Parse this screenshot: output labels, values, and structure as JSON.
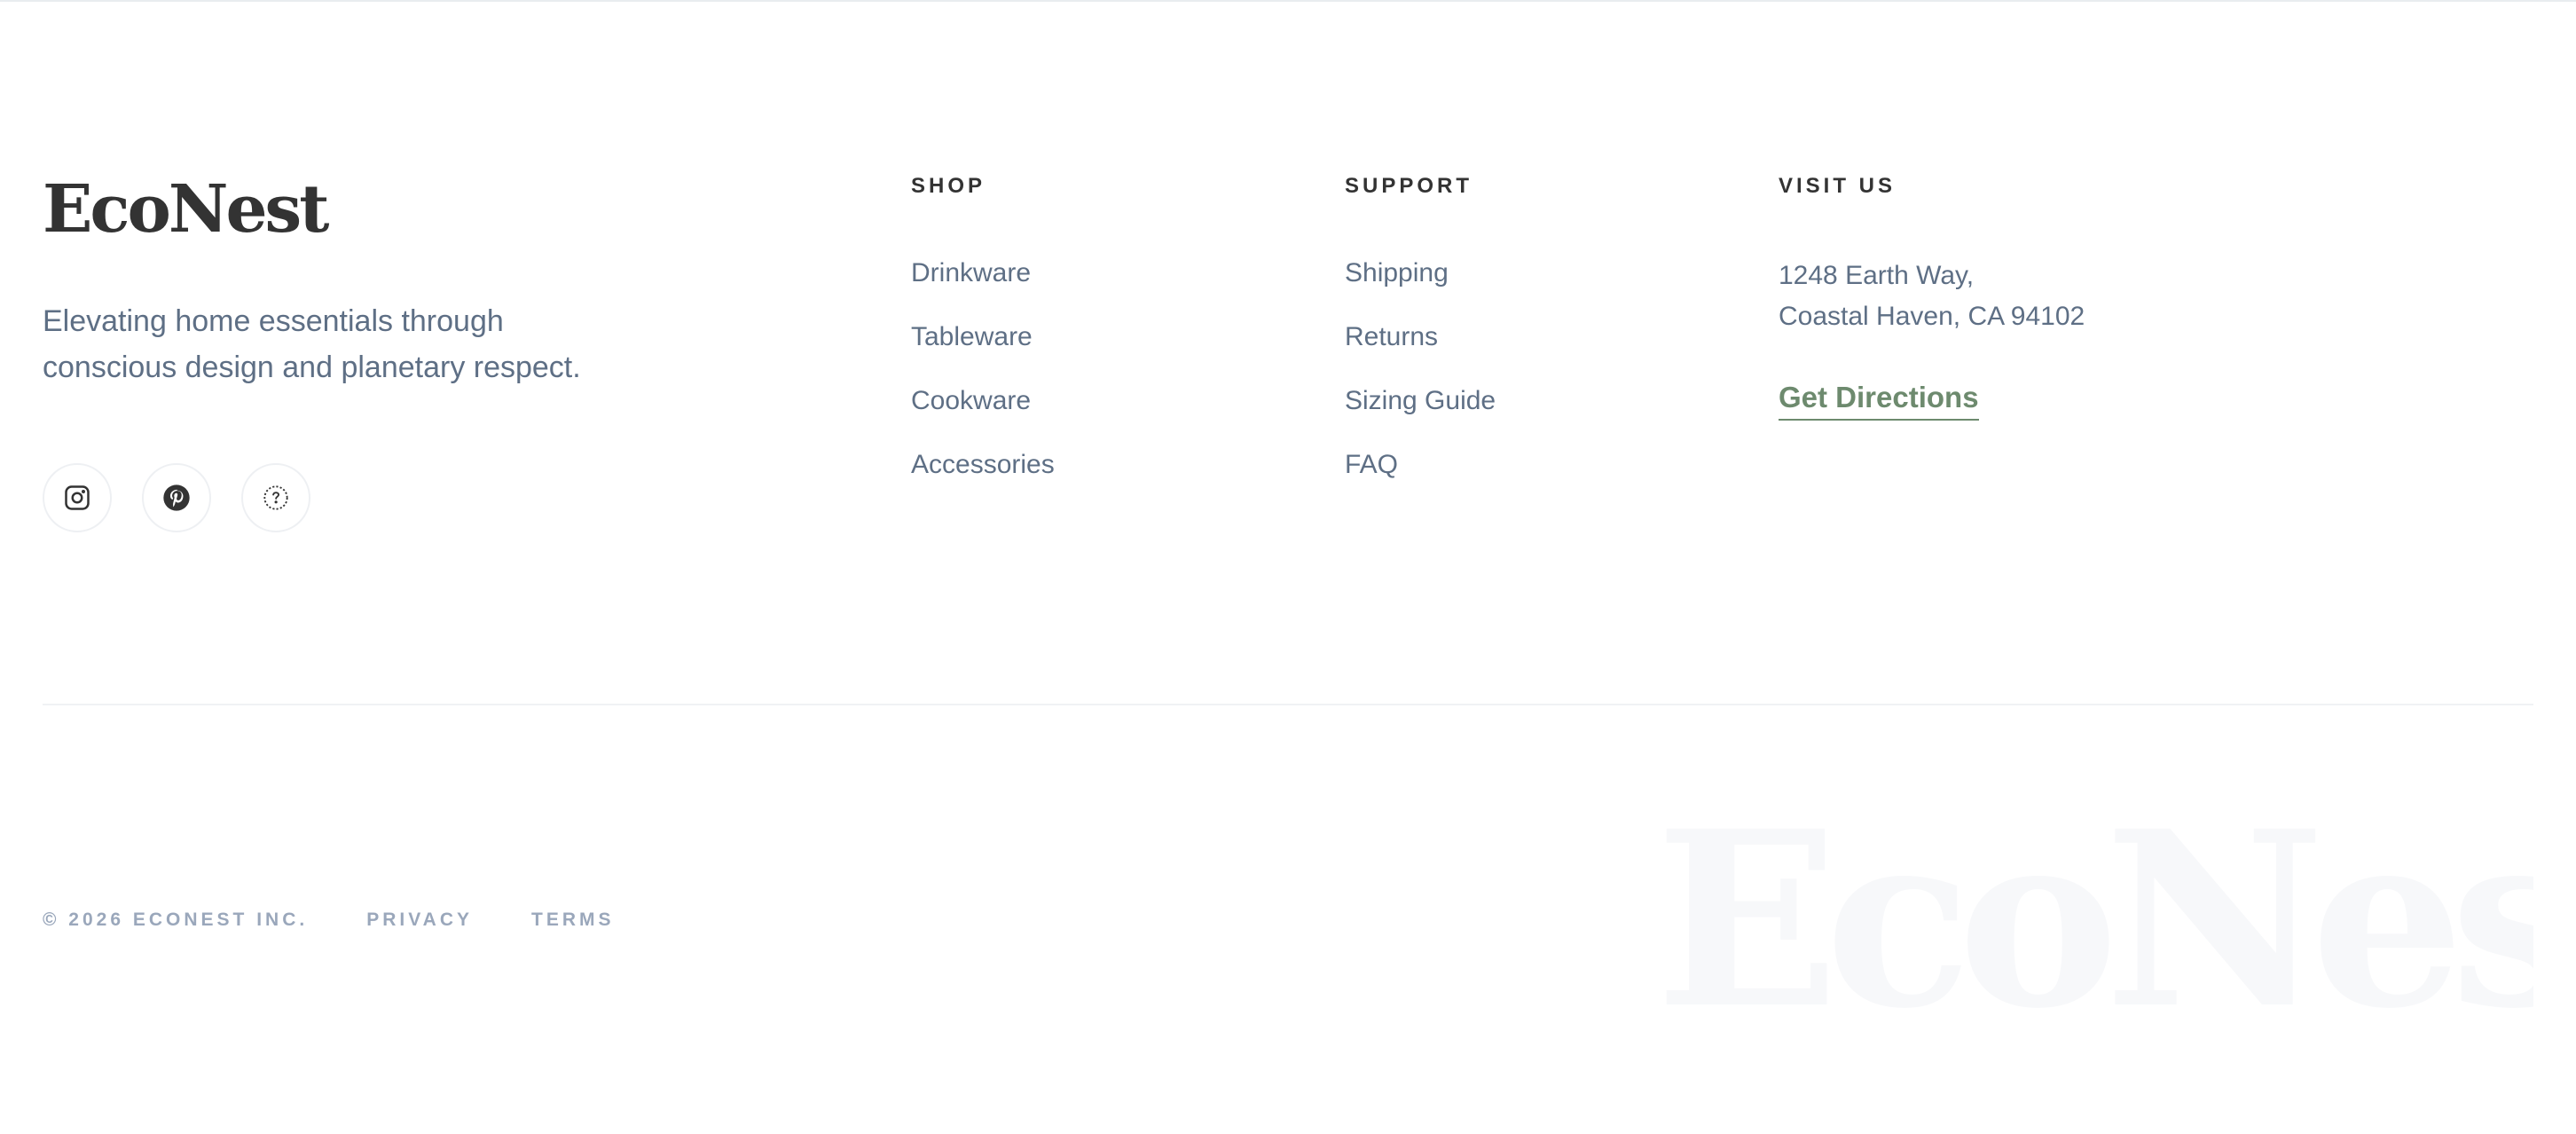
{
  "brand": {
    "name": "EcoNest",
    "tagline_line1": "Elevating home essentials through",
    "tagline_line2": "conscious design and planetary respect."
  },
  "socials": [
    {
      "icon": "instagram-icon"
    },
    {
      "icon": "pinterest-icon"
    },
    {
      "icon": "dotted-circle-icon"
    }
  ],
  "shop": {
    "heading": "SHOP",
    "links": [
      "Drinkware",
      "Tableware",
      "Cookware",
      "Accessories"
    ]
  },
  "support": {
    "heading": "SUPPORT",
    "links": [
      "Shipping",
      "Returns",
      "Sizing Guide",
      "FAQ"
    ]
  },
  "visit": {
    "heading": "VISIT US",
    "address_line1": "1248 Earth Way,",
    "address_line2": "Coastal Haven, CA 94102",
    "directions_label": "Get Directions"
  },
  "legal": {
    "copyright": "© 2026 ECONEST INC.",
    "privacy": "PRIVACY",
    "terms": "TERMS"
  },
  "watermark": "EcoNest",
  "colors": {
    "heading": "#333333",
    "body_text": "#5e6f85",
    "accent_green": "#6d8a6e",
    "legal_text": "#9aa7bb",
    "divider": "#f0f2f4"
  }
}
